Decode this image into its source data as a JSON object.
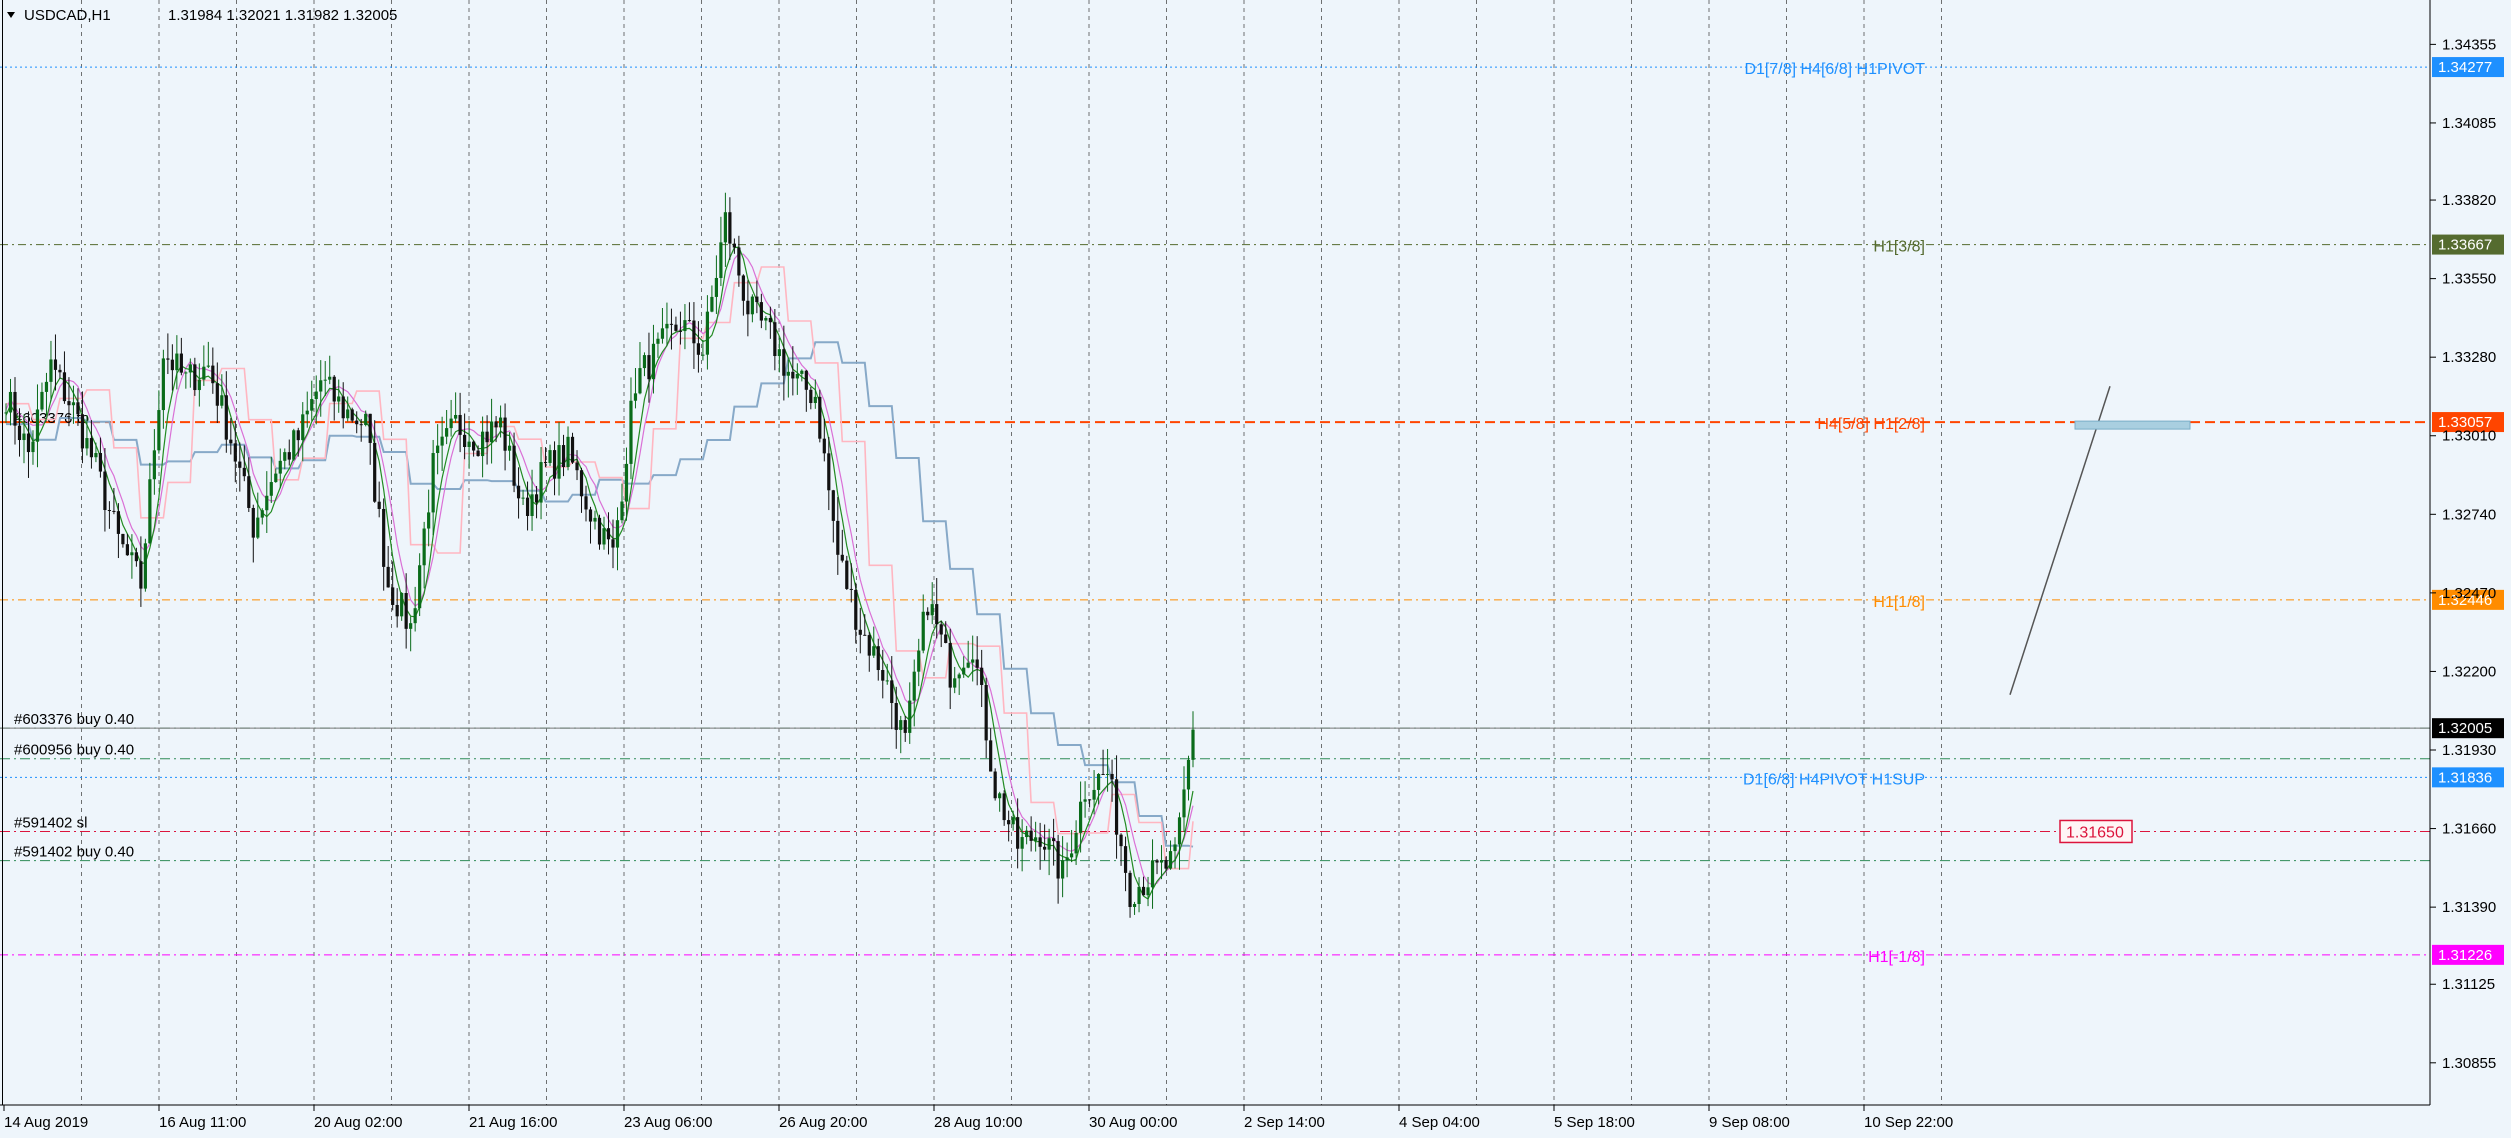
{
  "header": {
    "symbol": "USDCAD,H1",
    "ohlc": "1.31984 1.32021 1.31982 1.32005"
  },
  "chart_data": {
    "type": "candlestick",
    "symbol": "USDCAD",
    "timeframe": "H1",
    "ylim": [
      1.3071,
      1.3448
    ],
    "price_ticks": [
      "1.34355",
      "1.34085",
      "1.33820",
      "1.33550",
      "1.33280",
      "1.33010",
      "1.32740",
      "1.32470",
      "1.32200",
      "1.31930",
      "1.31660",
      "1.31390",
      "1.31125",
      "1.30855"
    ],
    "time_ticks": [
      "14 Aug 2019",
      "16 Aug 11:00",
      "20 Aug 02:00",
      "21 Aug 16:00",
      "23 Aug 06:00",
      "26 Aug 20:00",
      "28 Aug 10:00",
      "30 Aug 00:00",
      "2 Sep 14:00",
      "4 Sep 04:00",
      "5 Sep 18:00",
      "9 Sep 08:00",
      "10 Sep 22:00"
    ],
    "price_path_anchors": [
      [
        0,
        1.3315
      ],
      [
        5,
        1.3295
      ],
      [
        10,
        1.3325
      ],
      [
        15,
        1.331
      ],
      [
        20,
        1.329
      ],
      [
        25,
        1.3265
      ],
      [
        30,
        1.325
      ],
      [
        35,
        1.333
      ],
      [
        40,
        1.332
      ],
      [
        45,
        1.3325
      ],
      [
        50,
        1.33
      ],
      [
        55,
        1.327
      ],
      [
        60,
        1.329
      ],
      [
        65,
        1.33
      ],
      [
        70,
        1.332
      ],
      [
        75,
        1.331
      ],
      [
        80,
        1.3305
      ],
      [
        85,
        1.325
      ],
      [
        90,
        1.3235
      ],
      [
        95,
        1.329
      ],
      [
        100,
        1.3305
      ],
      [
        105,
        1.33
      ],
      [
        110,
        1.3305
      ],
      [
        115,
        1.3275
      ],
      [
        120,
        1.329
      ],
      [
        125,
        1.3295
      ],
      [
        130,
        1.3275
      ],
      [
        135,
        1.326
      ],
      [
        140,
        1.332
      ],
      [
        145,
        1.333
      ],
      [
        150,
        1.334
      ],
      [
        155,
        1.333
      ],
      [
        160,
        1.3375
      ],
      [
        165,
        1.3345
      ],
      [
        170,
        1.3335
      ],
      [
        175,
        1.332
      ],
      [
        180,
        1.3315
      ],
      [
        185,
        1.326
      ],
      [
        190,
        1.3235
      ],
      [
        195,
        1.322
      ],
      [
        200,
        1.3195
      ],
      [
        205,
        1.3245
      ],
      [
        210,
        1.322
      ],
      [
        215,
        1.323
      ],
      [
        220,
        1.318
      ],
      [
        225,
        1.316
      ],
      [
        230,
        1.3165
      ],
      [
        235,
        1.315
      ],
      [
        240,
        1.318
      ],
      [
        245,
        1.3185
      ],
      [
        250,
        1.3145
      ],
      [
        255,
        1.315
      ],
      [
        260,
        1.3155
      ],
      [
        264,
        1.32
      ]
    ],
    "levels": [
      {
        "price": 1.34277,
        "label": "1.34277",
        "text": "D1[7/8] H4[6/8] H1PIVOT",
        "color": "#1e90ff",
        "style": "dotted"
      },
      {
        "price": 1.33667,
        "label": "1.33667",
        "text": "H1[3/8]",
        "color": "#556b2f",
        "style": "dashdot"
      },
      {
        "price": 1.33057,
        "label": "1.33057",
        "text": "H4[5/8] H1[2/8]",
        "color": "#ff4500",
        "style": "dashed"
      },
      {
        "price": 1.32446,
        "label": "1.32446",
        "text": "H1[1/8]",
        "color": "#ff8c00",
        "style": "dashdot"
      },
      {
        "price": 1.31836,
        "label": "1.31836",
        "text": "D1[6/8] H4PIVOT H1SUP",
        "color": "#1e90ff",
        "style": "dotted"
      },
      {
        "price": 1.31226,
        "label": "1.31226",
        "text": "H1[-1/8]",
        "color": "#ff00ff",
        "style": "dashdot"
      }
    ],
    "current_price": {
      "price": 1.32005,
      "label": "1.32005"
    },
    "trade_lines": [
      {
        "price": 1.32005,
        "text": "#603376 buy 0.40",
        "color": "#2e8b57"
      },
      {
        "price": 1.319,
        "text": "#600956 buy 0.40",
        "color": "#2e8b57"
      },
      {
        "price": 1.3165,
        "text": "#591402 sl",
        "color": "#dc143c"
      },
      {
        "price": 1.3155,
        "text": "#591402 buy 0.40",
        "color": "#2e8b57"
      }
    ],
    "tp_label": {
      "price": 1.3304,
      "text": "#603376 tp"
    },
    "sl_box": {
      "price": 1.3165,
      "text": "1.31650",
      "color": "#dc143c"
    },
    "colors": {
      "bull": "#0a6b1a",
      "bear": "#111111",
      "ma_fast": "#228b22",
      "ma_pink": "#ffb6c1",
      "ma_violet": "#da70d6",
      "ma_slow": "#87a9c8",
      "background": "#eef5fb",
      "grid": "#333333"
    }
  }
}
